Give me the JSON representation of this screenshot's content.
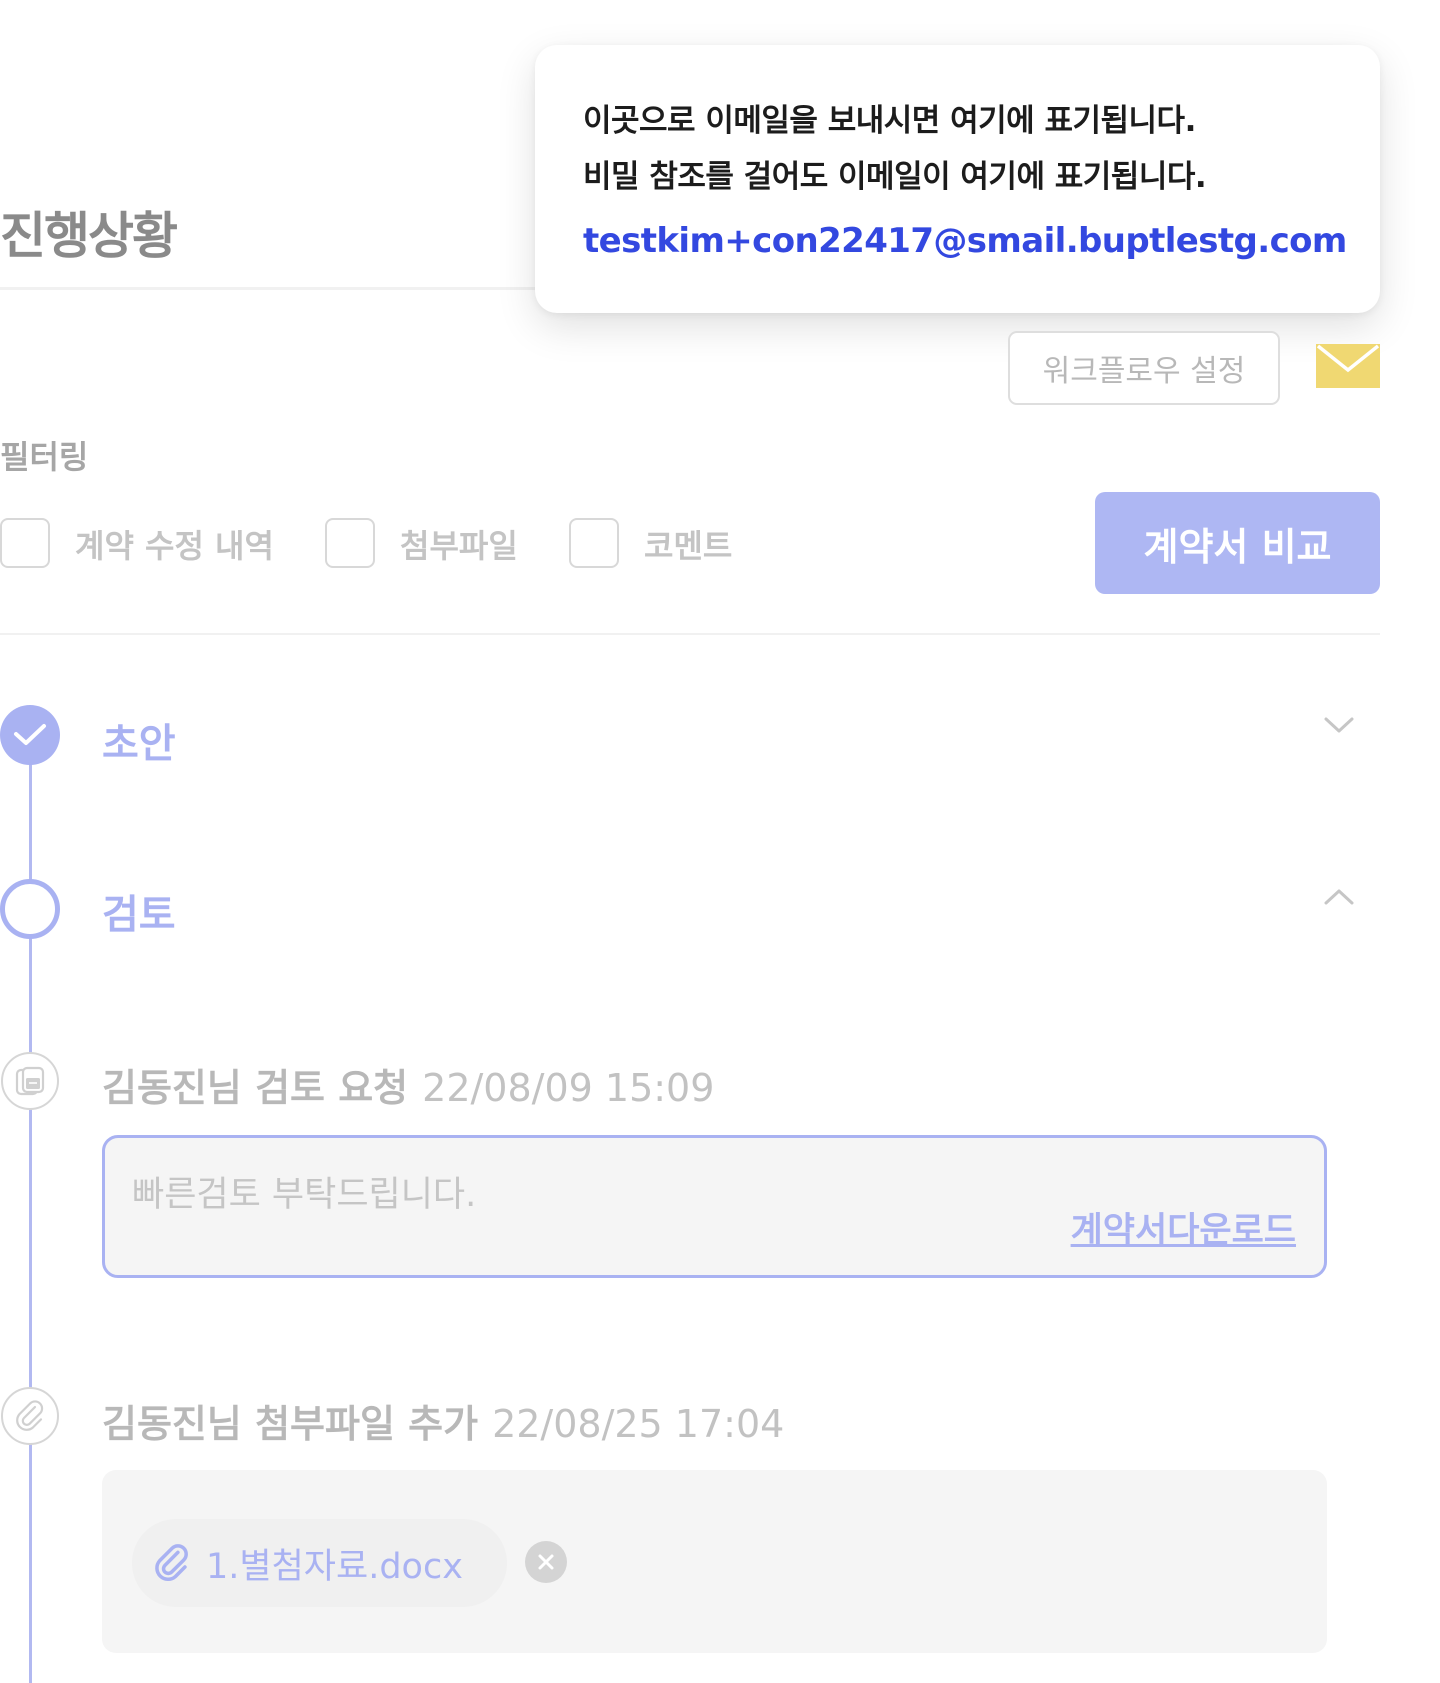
{
  "page": {
    "title": "진행상황"
  },
  "tooltip": {
    "line1": "이곳으로 이메일을 보내시면 여기에 표기됩니다.",
    "line2": "비밀 참조를 걸어도 이메일이 여기에 표기됩니다.",
    "email": "testkim+con22417@smail.buptlestg.com"
  },
  "toolbar": {
    "workflow_label": "워크플로우 설정",
    "mail_icon": "envelope-icon"
  },
  "filter": {
    "label": "필터링",
    "options": [
      {
        "label": "계약 수정 내역",
        "checked": false
      },
      {
        "label": "첨부파일",
        "checked": false
      },
      {
        "label": "코멘트",
        "checked": false
      }
    ],
    "compare_label": "계약서 비교"
  },
  "timeline": {
    "steps": [
      {
        "label": "초안",
        "status": "done",
        "expanded": false
      },
      {
        "label": "검토",
        "status": "current",
        "expanded": true
      }
    ],
    "events": [
      {
        "type": "review-request",
        "title": "김동진님 검토 요청",
        "time": "22/08/09 15:09",
        "comment": "빠른검토 부탁드립니다.",
        "link": "계약서다운로드"
      },
      {
        "type": "attachment",
        "title": "김동진님 첨부파일 추가",
        "time": "22/08/25 17:04",
        "file": "1.별첨자료.docx"
      }
    ]
  },
  "colors": {
    "accent": "#a9b2f2",
    "accent_button": "#aeb7f3",
    "email_link": "#3348e0",
    "mail_icon": "#f0d872"
  }
}
